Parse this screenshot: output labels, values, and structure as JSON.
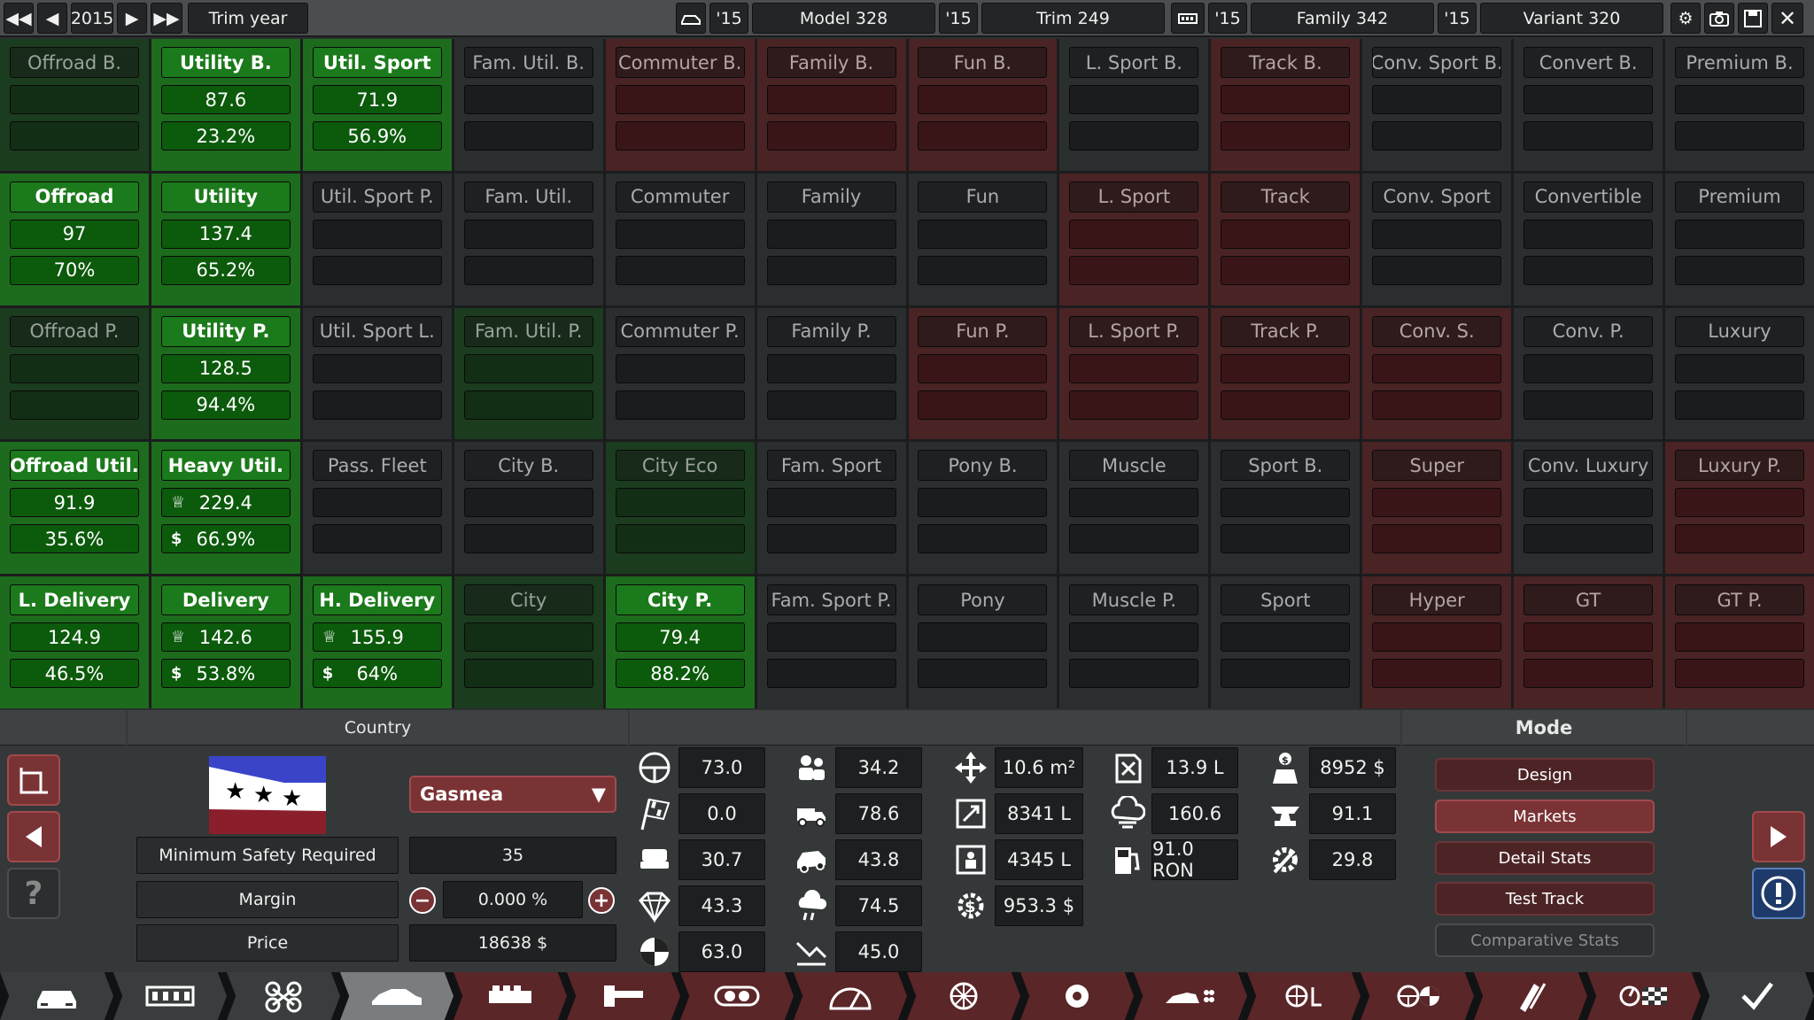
{
  "topbar": {
    "year": "2015",
    "trim_year": "Trim year",
    "model_year": "'15",
    "model": "Model 328",
    "trim_year2": "'15",
    "trim": "Trim 249",
    "family_year": "'15",
    "family": "Family 342",
    "variant_year": "'15",
    "variant": "Variant 320"
  },
  "markets": [
    {
      "label": "Offroad B.",
      "v1": "",
      "v2": "",
      "state": "dgreen"
    },
    {
      "label": "Utility B.",
      "v1": "87.6",
      "v2": "23.2%",
      "state": "green"
    },
    {
      "label": "Util. Sport",
      "v1": "71.9",
      "v2": "56.9%",
      "state": "green"
    },
    {
      "label": "Fam. Util. B.",
      "v1": "",
      "v2": "",
      "state": "gray"
    },
    {
      "label": "Commuter B.",
      "v1": "",
      "v2": "",
      "state": "red"
    },
    {
      "label": "Family B.",
      "v1": "",
      "v2": "",
      "state": "red"
    },
    {
      "label": "Fun B.",
      "v1": "",
      "v2": "",
      "state": "red"
    },
    {
      "label": "L. Sport B.",
      "v1": "",
      "v2": "",
      "state": "gray"
    },
    {
      "label": "Track B.",
      "v1": "",
      "v2": "",
      "state": "red"
    },
    {
      "label": "Conv. Sport B.",
      "v1": "",
      "v2": "",
      "state": "gray"
    },
    {
      "label": "Convert B.",
      "v1": "",
      "v2": "",
      "state": "gray"
    },
    {
      "label": "Premium B.",
      "v1": "",
      "v2": "",
      "state": "gray"
    },
    {
      "label": "Offroad",
      "v1": "97",
      "v2": "70%",
      "state": "green"
    },
    {
      "label": "Utility",
      "v1": "137.4",
      "v2": "65.2%",
      "state": "green"
    },
    {
      "label": "Util. Sport P.",
      "v1": "",
      "v2": "",
      "state": "gray"
    },
    {
      "label": "Fam. Util.",
      "v1": "",
      "v2": "",
      "state": "gray"
    },
    {
      "label": "Commuter",
      "v1": "",
      "v2": "",
      "state": "gray"
    },
    {
      "label": "Family",
      "v1": "",
      "v2": "",
      "state": "gray"
    },
    {
      "label": "Fun",
      "v1": "",
      "v2": "",
      "state": "gray"
    },
    {
      "label": "L. Sport",
      "v1": "",
      "v2": "",
      "state": "red"
    },
    {
      "label": "Track",
      "v1": "",
      "v2": "",
      "state": "red"
    },
    {
      "label": "Conv. Sport",
      "v1": "",
      "v2": "",
      "state": "gray"
    },
    {
      "label": "Convertible",
      "v1": "",
      "v2": "",
      "state": "gray"
    },
    {
      "label": "Premium",
      "v1": "",
      "v2": "",
      "state": "gray"
    },
    {
      "label": "Offroad P.",
      "v1": "",
      "v2": "",
      "state": "dgreen"
    },
    {
      "label": "Utility P.",
      "v1": "128.5",
      "v2": "94.4%",
      "state": "green"
    },
    {
      "label": "Util. Sport L.",
      "v1": "",
      "v2": "",
      "state": "gray"
    },
    {
      "label": "Fam. Util. P.",
      "v1": "",
      "v2": "",
      "state": "dgreen"
    },
    {
      "label": "Commuter P.",
      "v1": "",
      "v2": "",
      "state": "gray"
    },
    {
      "label": "Family P.",
      "v1": "",
      "v2": "",
      "state": "gray"
    },
    {
      "label": "Fun P.",
      "v1": "",
      "v2": "",
      "state": "red"
    },
    {
      "label": "L. Sport P.",
      "v1": "",
      "v2": "",
      "state": "red"
    },
    {
      "label": "Track P.",
      "v1": "",
      "v2": "",
      "state": "red"
    },
    {
      "label": "Conv. S.",
      "v1": "",
      "v2": "",
      "state": "red"
    },
    {
      "label": "Conv. P.",
      "v1": "",
      "v2": "",
      "state": "gray"
    },
    {
      "label": "Luxury",
      "v1": "",
      "v2": "",
      "state": "gray"
    },
    {
      "label": "Offroad Util.",
      "v1": "91.9",
      "v2": "35.6%",
      "state": "green"
    },
    {
      "label": "Heavy Util.",
      "v1": "229.4",
      "v2": "66.9%",
      "state": "green",
      "icons": true
    },
    {
      "label": "Pass. Fleet",
      "v1": "",
      "v2": "",
      "state": "gray"
    },
    {
      "label": "City B.",
      "v1": "",
      "v2": "",
      "state": "gray"
    },
    {
      "label": "City Eco",
      "v1": "",
      "v2": "",
      "state": "dgreen"
    },
    {
      "label": "Fam. Sport",
      "v1": "",
      "v2": "",
      "state": "gray"
    },
    {
      "label": "Pony B.",
      "v1": "",
      "v2": "",
      "state": "gray"
    },
    {
      "label": "Muscle",
      "v1": "",
      "v2": "",
      "state": "gray"
    },
    {
      "label": "Sport B.",
      "v1": "",
      "v2": "",
      "state": "gray"
    },
    {
      "label": "Super",
      "v1": "",
      "v2": "",
      "state": "red"
    },
    {
      "label": "Conv. Luxury",
      "v1": "",
      "v2": "",
      "state": "gray"
    },
    {
      "label": "Luxury P.",
      "v1": "",
      "v2": "",
      "state": "red"
    },
    {
      "label": "L. Delivery",
      "v1": "124.9",
      "v2": "46.5%",
      "state": "green"
    },
    {
      "label": "Delivery",
      "v1": "142.6",
      "v2": "53.8%",
      "state": "green",
      "icons": true
    },
    {
      "label": "H. Delivery",
      "v1": "155.9",
      "v2": "64%",
      "state": "green",
      "icons": true
    },
    {
      "label": "City",
      "v1": "",
      "v2": "",
      "state": "dgreen"
    },
    {
      "label": "City P.",
      "v1": "79.4",
      "v2": "88.2%",
      "state": "green"
    },
    {
      "label": "Fam. Sport P.",
      "v1": "",
      "v2": "",
      "state": "gray"
    },
    {
      "label": "Pony",
      "v1": "",
      "v2": "",
      "state": "gray"
    },
    {
      "label": "Muscle P.",
      "v1": "",
      "v2": "",
      "state": "gray"
    },
    {
      "label": "Sport",
      "v1": "",
      "v2": "",
      "state": "gray"
    },
    {
      "label": "Hyper",
      "v1": "",
      "v2": "",
      "state": "red"
    },
    {
      "label": "GT",
      "v1": "",
      "v2": "",
      "state": "red"
    },
    {
      "label": "GT P.",
      "v1": "",
      "v2": "",
      "state": "red"
    }
  ],
  "country": {
    "header": "Country",
    "selected": "Gasmea",
    "min_safety_label": "Minimum Safety Required",
    "min_safety_value": "35",
    "margin_label": "Margin",
    "margin_value": "0.000 %",
    "price_label": "Price",
    "price_value": "18638 $"
  },
  "stats": {
    "col1": [
      "73.0",
      "0.0",
      "30.7",
      "43.3",
      "63.0"
    ],
    "col2": [
      "34.2",
      "78.6",
      "43.8",
      "74.5",
      "45.0"
    ],
    "col3": [
      "10.6 m²",
      "8341 L",
      "4345 L",
      "953.3 $"
    ],
    "col4": [
      "13.9 L",
      "160.6",
      "91.0 RON"
    ],
    "col5": [
      "8952 $",
      "91.1",
      "29.8"
    ]
  },
  "mode": {
    "header": "Mode",
    "buttons": [
      "Design",
      "Markets",
      "Detail Stats",
      "Test Track",
      "Comparative Stats"
    ]
  },
  "colors": {
    "green": "#1d6b1d",
    "red": "#4a2325",
    "accent": "#7a3335"
  }
}
